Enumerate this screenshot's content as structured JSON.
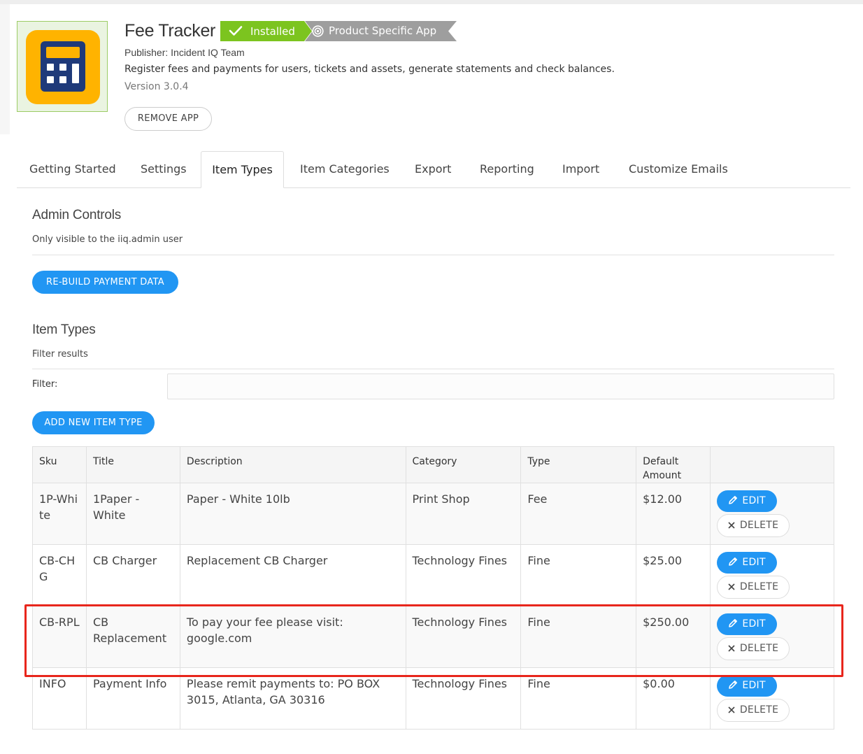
{
  "app": {
    "title": "Fee Tracker",
    "status_badge": "Installed",
    "type_badge": "Product Specific App",
    "publisher": "Publisher: Incident IQ Team",
    "description": "Register fees and payments for users, tickets and assets, generate statements and check balances.",
    "version": "Version 3.0.4",
    "remove_label": "REMOVE APP",
    "icon": "calculator-icon"
  },
  "tabs": [
    {
      "label": "Getting Started"
    },
    {
      "label": "Settings"
    },
    {
      "label": "Item Types",
      "active": true
    },
    {
      "label": "Item Categories"
    },
    {
      "label": "Export"
    },
    {
      "label": "Reporting"
    },
    {
      "label": "Import"
    },
    {
      "label": "Customize Emails"
    }
  ],
  "admin": {
    "heading": "Admin Controls",
    "subtext": "Only visible to the iiq.admin user",
    "rebuild_label": "RE-BUILD PAYMENT DATA"
  },
  "item_types": {
    "heading": "Item Types",
    "filter_heading": "Filter results",
    "filter_label": "Filter:",
    "filter_value": "",
    "add_label": "ADD NEW ITEM TYPE",
    "columns": [
      "Sku",
      "Title",
      "Description",
      "Category",
      "Type",
      "Default Amount",
      ""
    ],
    "edit_label": "EDIT",
    "delete_label": "DELETE",
    "rows": [
      {
        "sku": "1P-White",
        "title": "1Paper - White",
        "description": "Paper - White 10lb",
        "category": "Print Shop",
        "type": "Fee",
        "amount": "$12.00"
      },
      {
        "sku": "CB-CHG",
        "title": "CB Charger",
        "description": "Replacement CB Charger",
        "category": "Technology Fines",
        "type": "Fine",
        "amount": "$25.00"
      },
      {
        "sku": "CB-RPL",
        "title": "CB Replacement",
        "description": "To pay your fee please visit: google.com",
        "category": "Technology Fines",
        "type": "Fine",
        "amount": "$250.00"
      },
      {
        "sku": "INFO",
        "title": "Payment Info",
        "description": "Please remit payments to: PO BOX 3015, Atlanta, GA 30316",
        "category": "Technology Fines",
        "type": "Fine",
        "amount": "$0.00"
      }
    ]
  },
  "colors": {
    "primary": "#2196f3",
    "installed_green": "#7cc41f",
    "badge_gray": "#9e9e9e",
    "icon_yellow": "#ffb300",
    "icon_navy": "#1f3a7a",
    "highlight_red": "#e8261c"
  }
}
